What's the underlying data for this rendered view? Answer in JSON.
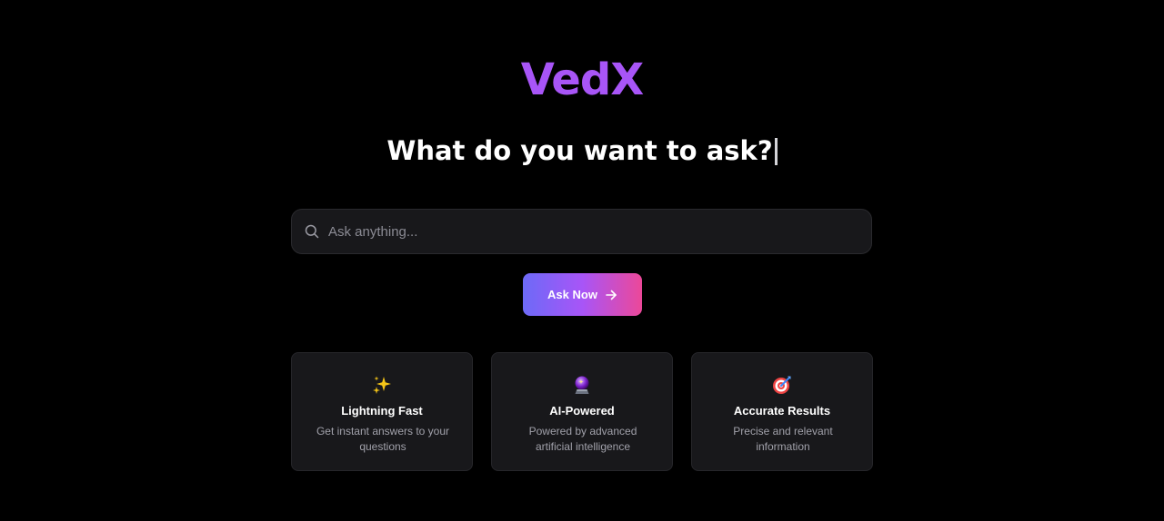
{
  "brand": {
    "name": "VedX",
    "color": "#a855f7"
  },
  "hero": {
    "headline": "What do you want to ask?"
  },
  "search": {
    "icon": "search-icon",
    "placeholder": "Ask anything...",
    "value": ""
  },
  "ask_button": {
    "label": "Ask Now",
    "icon": "arrow-right-icon",
    "gradient": [
      "#6d6af7",
      "#a855f7",
      "#ec4899"
    ]
  },
  "features": [
    {
      "icon": "sparkles-icon",
      "title": "Lightning Fast",
      "description": "Get instant answers to your questions"
    },
    {
      "icon": "crystal-ball-icon",
      "title": "AI-Powered",
      "description": "Powered by advanced artificial intelligence"
    },
    {
      "icon": "target-icon",
      "title": "Accurate Results",
      "description": "Precise and relevant information"
    }
  ]
}
